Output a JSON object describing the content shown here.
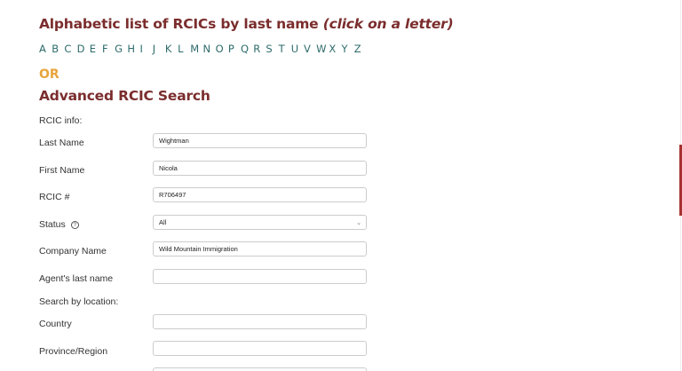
{
  "heading": {
    "title": "Alphabetic list of RCICs by last name",
    "hint": "(click on a letter)"
  },
  "alphabet": [
    "A",
    "B",
    "C",
    "D",
    "E",
    "F",
    "G",
    "H",
    "I",
    "J",
    "K",
    "L",
    "M",
    "N",
    "O",
    "P",
    "Q",
    "R",
    "S",
    "T",
    "U",
    "V",
    "W",
    "X",
    "Y",
    "Z"
  ],
  "or_label": "OR",
  "advanced": {
    "title": "Advanced RCIC Search",
    "rcic_info_label": "RCIC info:",
    "location_label": "Search by location:",
    "last_name": {
      "label": "Last Name",
      "value": "Wightman"
    },
    "first_name": {
      "label": "First Name",
      "value": "Nicola"
    },
    "rcic_number": {
      "label": "RCIC #",
      "value": "R706497"
    },
    "status": {
      "label": "Status",
      "value": "All",
      "help_icon": "question-circle-icon"
    },
    "company": {
      "label": "Company Name",
      "value": "Wild Mountain Immigration"
    },
    "agent_last_name": {
      "label": "Agent's last name",
      "value": ""
    },
    "country": {
      "label": "Country",
      "value": ""
    },
    "province": {
      "label": "Province/Region",
      "value": ""
    }
  },
  "colors": {
    "heading": "#7b2d2d",
    "letters": "#2e6b6b",
    "or": "#e8a43c",
    "accent": "#a83232"
  }
}
